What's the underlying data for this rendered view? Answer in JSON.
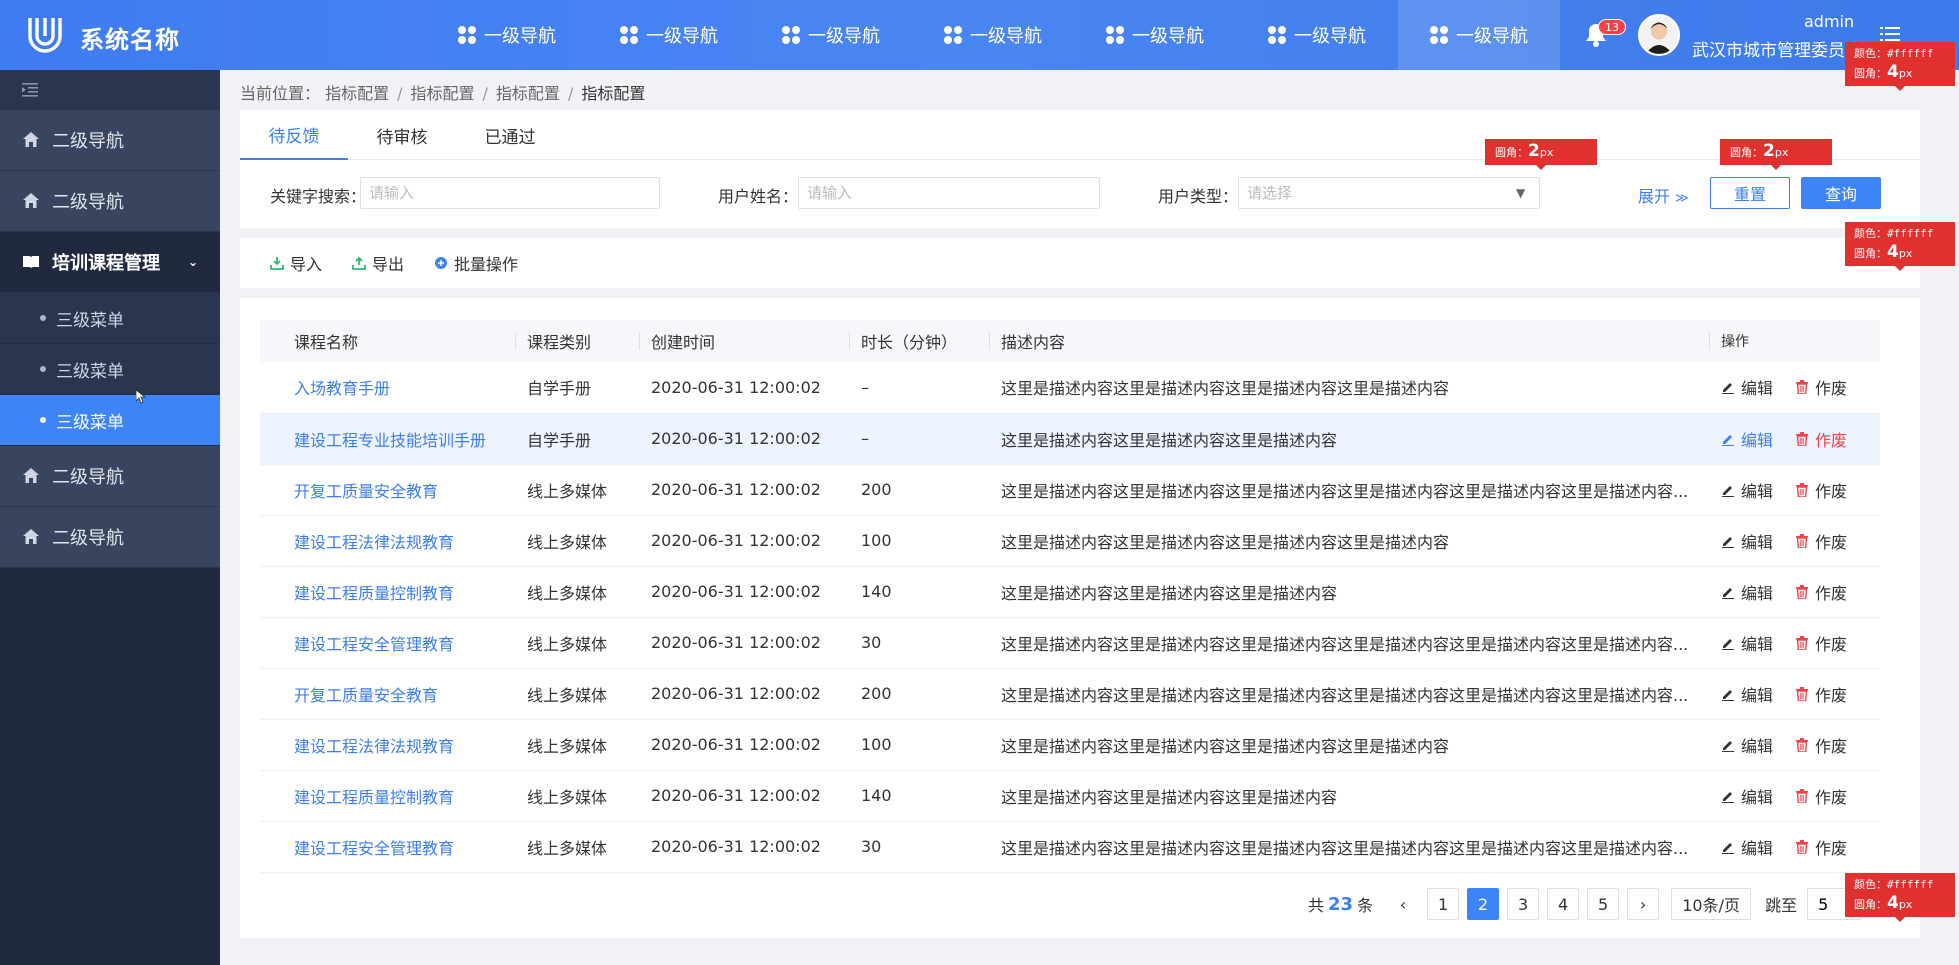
{
  "header": {
    "system_name": "系统名称",
    "nav": [
      "一级导航",
      "一级导航",
      "一级导航",
      "一级导航",
      "一级导航",
      "一级导航",
      "一级导航"
    ],
    "active_nav_index": 6,
    "notification_count": "13",
    "user_name": "admin",
    "user_org": "武汉市城市管理委员会"
  },
  "sidebar": {
    "items": [
      {
        "label": "二级导航"
      },
      {
        "label": "二级导航"
      }
    ],
    "open_group": {
      "label": "培训课程管理",
      "children": [
        "三级菜单",
        "三级菜单",
        "三级菜单"
      ],
      "active_child_index": 2
    },
    "items_after": [
      {
        "label": "二级导航"
      },
      {
        "label": "二级导航"
      }
    ]
  },
  "breadcrumb": {
    "prefix": "当前位置：",
    "items": [
      "指标配置",
      "指标配置",
      "指标配置"
    ],
    "current": "指标配置",
    "sep": "/"
  },
  "tabs": [
    "待反馈",
    "待审核",
    "已通过"
  ],
  "filter": {
    "keyword_label": "关键字搜索：",
    "keyword_placeholder": "请输入",
    "username_label": "用户姓名：",
    "username_placeholder": "请输入",
    "usertype_label": "用户类型：",
    "usertype_placeholder": "请选择",
    "expand_label": "展开",
    "reset_label": "重置",
    "query_label": "查询"
  },
  "toolbar": {
    "import_label": "导入",
    "export_label": "导出",
    "batch_label": "批量操作"
  },
  "table": {
    "columns": [
      "课程名称",
      "课程类别",
      "创建时间",
      "时长（分钟）",
      "描述内容",
      "操作"
    ],
    "edit_label": "编辑",
    "delete_label": "作废",
    "highlighted_row": 1,
    "rows": [
      {
        "name": "入场教育手册",
        "category": "自学手册",
        "time": "2020-06-31 12:00:02",
        "duration": "–",
        "desc": "这里是描述内容这里是描述内容这里是描述内容这里是描述内容"
      },
      {
        "name": "建设工程专业技能培训手册",
        "category": "自学手册",
        "time": "2020-06-31 12:00:02",
        "duration": "–",
        "desc": "这里是描述内容这里是描述内容这里是描述内容"
      },
      {
        "name": "开复工质量安全教育",
        "category": "线上多媒体",
        "time": "2020-06-31 12:00:02",
        "duration": "200",
        "desc": "这里是描述内容这里是描述内容这里是描述内容这里是描述内容这里是描述内容这里是描述内容..."
      },
      {
        "name": "建设工程法律法规教育",
        "category": "线上多媒体",
        "time": "2020-06-31 12:00:02",
        "duration": "100",
        "desc": "这里是描述内容这里是描述内容这里是描述内容这里是描述内容"
      },
      {
        "name": "建设工程质量控制教育",
        "category": "线上多媒体",
        "time": "2020-06-31 12:00:02",
        "duration": "140",
        "desc": "这里是描述内容这里是描述内容这里是描述内容"
      },
      {
        "name": "建设工程安全管理教育",
        "category": "线上多媒体",
        "time": "2020-06-31 12:00:02",
        "duration": "30",
        "desc": "这里是描述内容这里是描述内容这里是描述内容这里是描述内容这里是描述内容这里是描述内容..."
      },
      {
        "name": "开复工质量安全教育",
        "category": "线上多媒体",
        "time": "2020-06-31 12:00:02",
        "duration": "200",
        "desc": "这里是描述内容这里是描述内容这里是描述内容这里是描述内容这里是描述内容这里是描述内容..."
      },
      {
        "name": "建设工程法律法规教育",
        "category": "线上多媒体",
        "time": "2020-06-31 12:00:02",
        "duration": "100",
        "desc": "这里是描述内容这里是描述内容这里是描述内容这里是描述内容"
      },
      {
        "name": "建设工程质量控制教育",
        "category": "线上多媒体",
        "time": "2020-06-31 12:00:02",
        "duration": "140",
        "desc": "这里是描述内容这里是描述内容这里是描述内容"
      },
      {
        "name": "建设工程安全管理教育",
        "category": "线上多媒体",
        "time": "2020-06-31 12:00:02",
        "duration": "30",
        "desc": "这里是描述内容这里是描述内容这里是描述内容这里是描述内容这里是描述内容这里是描述内容..."
      }
    ]
  },
  "pagination": {
    "total_prefix": "共",
    "total": "23",
    "total_suffix": "条",
    "pages": [
      "1",
      "2",
      "3",
      "4",
      "5"
    ],
    "active_page_index": 1,
    "page_size": "10条/页",
    "jump_label": "跳至",
    "jump_value": "5"
  },
  "annotations": {
    "radius_label": "圆角：",
    "radius_value": "2",
    "radius_value_large": "4",
    "unit": "px",
    "color_label": "颜色：",
    "color_value": "#ffffff"
  },
  "colors": {
    "primary": "#3d84f7",
    "sidebar_bg": "#20293f",
    "danger": "#f5424a",
    "annotation": "#e0312f"
  }
}
